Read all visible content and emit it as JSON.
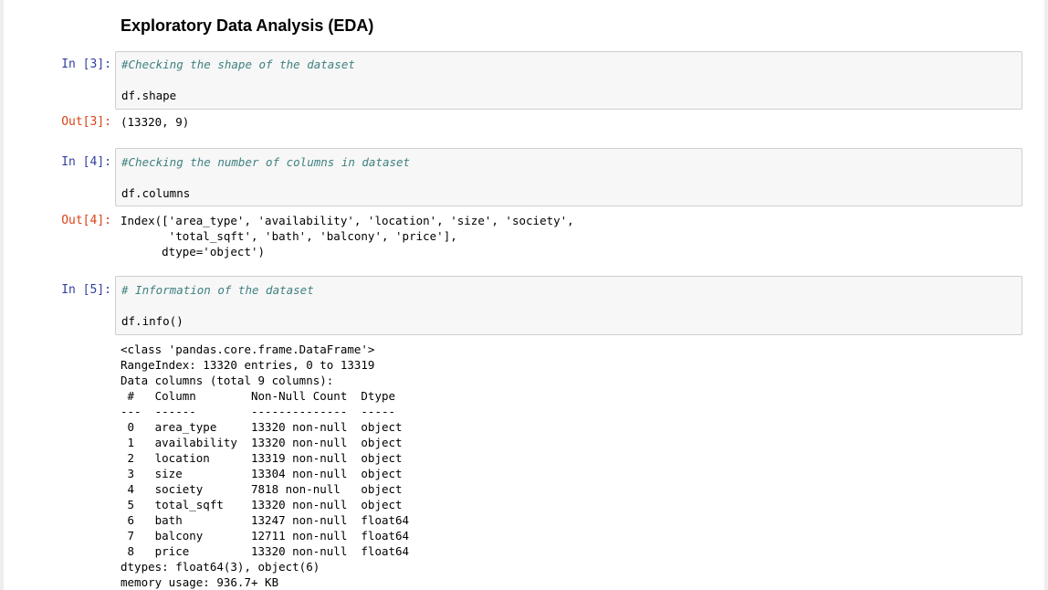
{
  "heading": "Exploratory Data Analysis (EDA)",
  "cells": [
    {
      "in_prompt": "In [3]:",
      "comment": "#Checking the shape of the dataset",
      "code": "df.shape",
      "out_prompt": "Out[3]:",
      "output": "(13320, 9)"
    },
    {
      "in_prompt": "In [4]:",
      "comment": "#Checking the number of columns in dataset",
      "code": "df.columns",
      "out_prompt": "Out[4]:",
      "output": "Index(['area_type', 'availability', 'location', 'size', 'society',\n       'total_sqft', 'bath', 'balcony', 'price'],\n      dtype='object')"
    },
    {
      "in_prompt": "In [5]:",
      "comment": "# Information of the dataset",
      "code": "df.info()",
      "output": "<class 'pandas.core.frame.DataFrame'>\nRangeIndex: 13320 entries, 0 to 13319\nData columns (total 9 columns):\n #   Column        Non-Null Count  Dtype  \n---  ------        --------------  -----  \n 0   area_type     13320 non-null  object \n 1   availability  13320 non-null  object \n 2   location      13319 non-null  object \n 3   size          13304 non-null  object \n 4   society       7818 non-null   object \n 5   total_sqft    13320 non-null  object \n 6   bath          13247 non-null  float64\n 7   balcony       12711 non-null  float64\n 8   price         13320 non-null  float64\ndtypes: float64(3), object(6)\nmemory usage: 936.7+ KB"
    }
  ]
}
